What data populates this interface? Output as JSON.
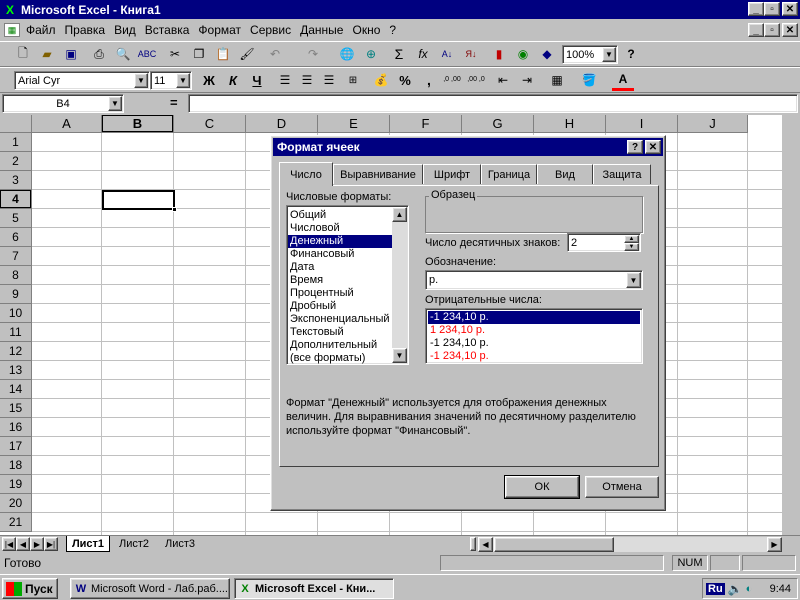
{
  "app": {
    "title": "Microsoft Excel - Книга1"
  },
  "menu": [
    "Файл",
    "Правка",
    "Вид",
    "Вставка",
    "Формат",
    "Сервис",
    "Данные",
    "Окно",
    "?"
  ],
  "toolbar": {
    "zoom": "100%"
  },
  "format_toolbar": {
    "font": "Arial Cyr",
    "size": "11",
    "bold": "Ж",
    "italic": "К",
    "underline": "Ч",
    "percent": "%",
    "comma": ",",
    "inc_dec": ",0 ,00",
    "dec_dec": ",00 ,0"
  },
  "formula_bar": {
    "name_box": "B4",
    "equals": "="
  },
  "columns": [
    "A",
    "B",
    "C",
    "D",
    "E",
    "F",
    "G",
    "H",
    "I",
    "J"
  ],
  "rows": [
    "1",
    "2",
    "3",
    "4",
    "5",
    "6",
    "7",
    "8",
    "9",
    "10",
    "11",
    "12",
    "13",
    "14",
    "15",
    "16",
    "17",
    "18",
    "19",
    "20",
    "21"
  ],
  "sheets": [
    "Лист1",
    "Лист2",
    "Лист3"
  ],
  "status": {
    "ready": "Готово",
    "num": "NUM"
  },
  "taskbar": {
    "start": "Пуск",
    "word": "Microsoft Word - Лаб.раб....",
    "excel": "Microsoft Excel - Кни...",
    "lang": "Ru",
    "clock": "9:44"
  },
  "dialog": {
    "title": "Формат ячеек",
    "tabs": [
      "Число",
      "Выравнивание",
      "Шрифт",
      "Граница",
      "Вид",
      "Защита"
    ],
    "formats_label": "Числовые форматы:",
    "formats": [
      "Общий",
      "Числовой",
      "Денежный",
      "Финансовый",
      "Дата",
      "Время",
      "Процентный",
      "Дробный",
      "Экспоненциальный",
      "Текстовый",
      "Дополнительный",
      "(все форматы)"
    ],
    "selected_format": "Денежный",
    "sample_label": "Образец",
    "decimals_label": "Число десятичных знаков:",
    "decimals_value": "2",
    "symbol_label": "Обозначение:",
    "symbol_value": "р.",
    "negative_label": "Отрицательные числа:",
    "negatives": [
      {
        "text": "-1 234,10 р.",
        "color": "#000000",
        "selected": true
      },
      {
        "text": "1 234,10 р.",
        "color": "#ff0000",
        "selected": false
      },
      {
        "text": "-1 234,10 р.",
        "color": "#000000",
        "selected": false
      },
      {
        "text": "-1 234,10 р.",
        "color": "#ff0000",
        "selected": false
      }
    ],
    "description": "Формат \"Денежный\" используется для отображения денежных величин. Для выравнивания значений по десятичному разделителю используйте формат \"Финансовый\".",
    "ok": "ОК",
    "cancel": "Отмена"
  },
  "colors": {
    "title": "#000080",
    "selection": "#000080",
    "red": "#ff0000"
  }
}
